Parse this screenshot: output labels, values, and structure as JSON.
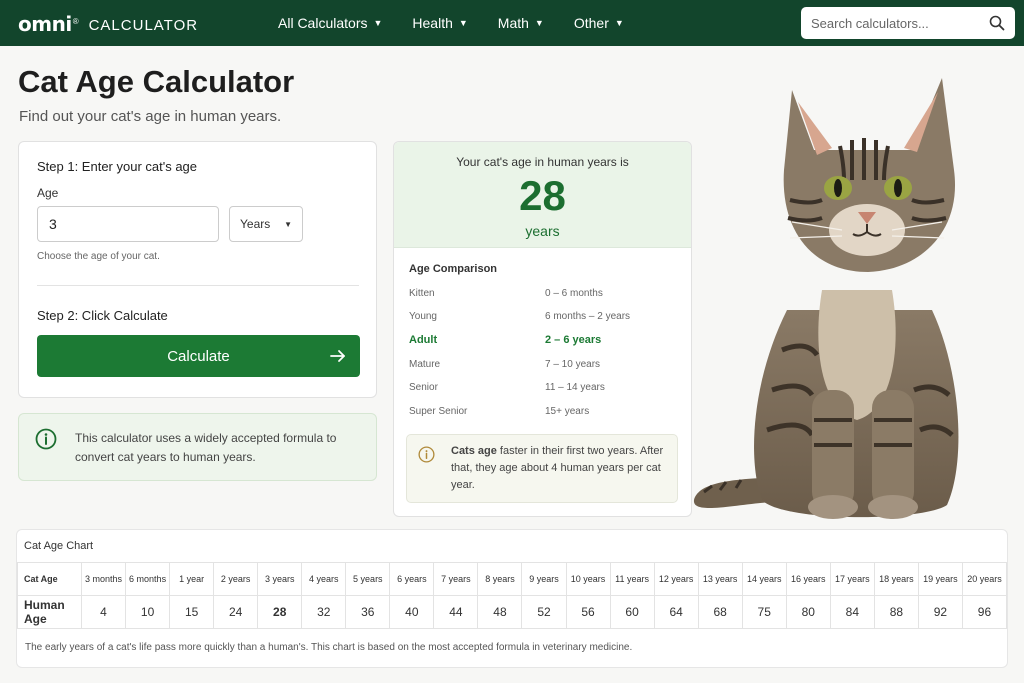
{
  "nav": {
    "logo_text": "omni",
    "logo_sub": "CALCULATOR",
    "items": [
      {
        "label": "All Calculators"
      },
      {
        "label": "Health"
      },
      {
        "label": "Math"
      },
      {
        "label": "Other"
      }
    ],
    "search_placeholder": "Search calculators..."
  },
  "page": {
    "title": "Cat Age Calculator",
    "subtitle": "Find out your cat's age in human years."
  },
  "form": {
    "step1": "Step 1: Enter your cat's age",
    "age_label": "Age",
    "age_value": "3",
    "unit_value": "Years",
    "hint": "Choose the age of your cat.",
    "step2": "Step 2: Click Calculate",
    "button_label": "Calculate"
  },
  "info": {
    "text": "This calculator uses a widely accepted formula to convert cat years to human years."
  },
  "result": {
    "caption": "Your cat's age in human years is",
    "value": "28",
    "unit": "years",
    "comparison_title": "Age Comparison",
    "rows": [
      {
        "name": "Kitten",
        "range": "0 – 6 months"
      },
      {
        "name": "Young",
        "range": "6 months – 2 years"
      },
      {
        "name": "Adult",
        "range": "2 – 6 years"
      },
      {
        "name": "Mature",
        "range": "7 – 10 years"
      },
      {
        "name": "Senior",
        "range": "11 – 14 years"
      },
      {
        "name": "Super Senior",
        "range": "15+ years"
      }
    ],
    "tip_bold": "Cats age",
    "tip_rest": " faster in their first two years. After that, they age about 4 human years per cat year."
  },
  "chart": {
    "title": "Cat Age Chart",
    "row1_label": "Cat Age",
    "row2_label": "Human Age",
    "cat_ages": [
      "3 months",
      "6 months",
      "1 year",
      "2 years",
      "3 years",
      "4 years",
      "5 years",
      "6 years",
      "7 years",
      "8 years",
      "9 years",
      "10 years",
      "11 years",
      "12 years",
      "13 years",
      "14 years",
      "16 years",
      "17 years",
      "18 years",
      "19 years",
      "20 years"
    ],
    "human_ages": [
      "4",
      "10",
      "15",
      "24",
      "28",
      "32",
      "36",
      "40",
      "44",
      "48",
      "52",
      "56",
      "60",
      "64",
      "68",
      "75",
      "80",
      "84",
      "88",
      "92",
      "96"
    ],
    "footnote": "The early years of a cat's life pass more quickly than a human's. This chart is based on the most accepted formula in veterinary medicine."
  },
  "colors": {
    "nav_bg": "#12452c",
    "accent": "#1c7a34"
  }
}
